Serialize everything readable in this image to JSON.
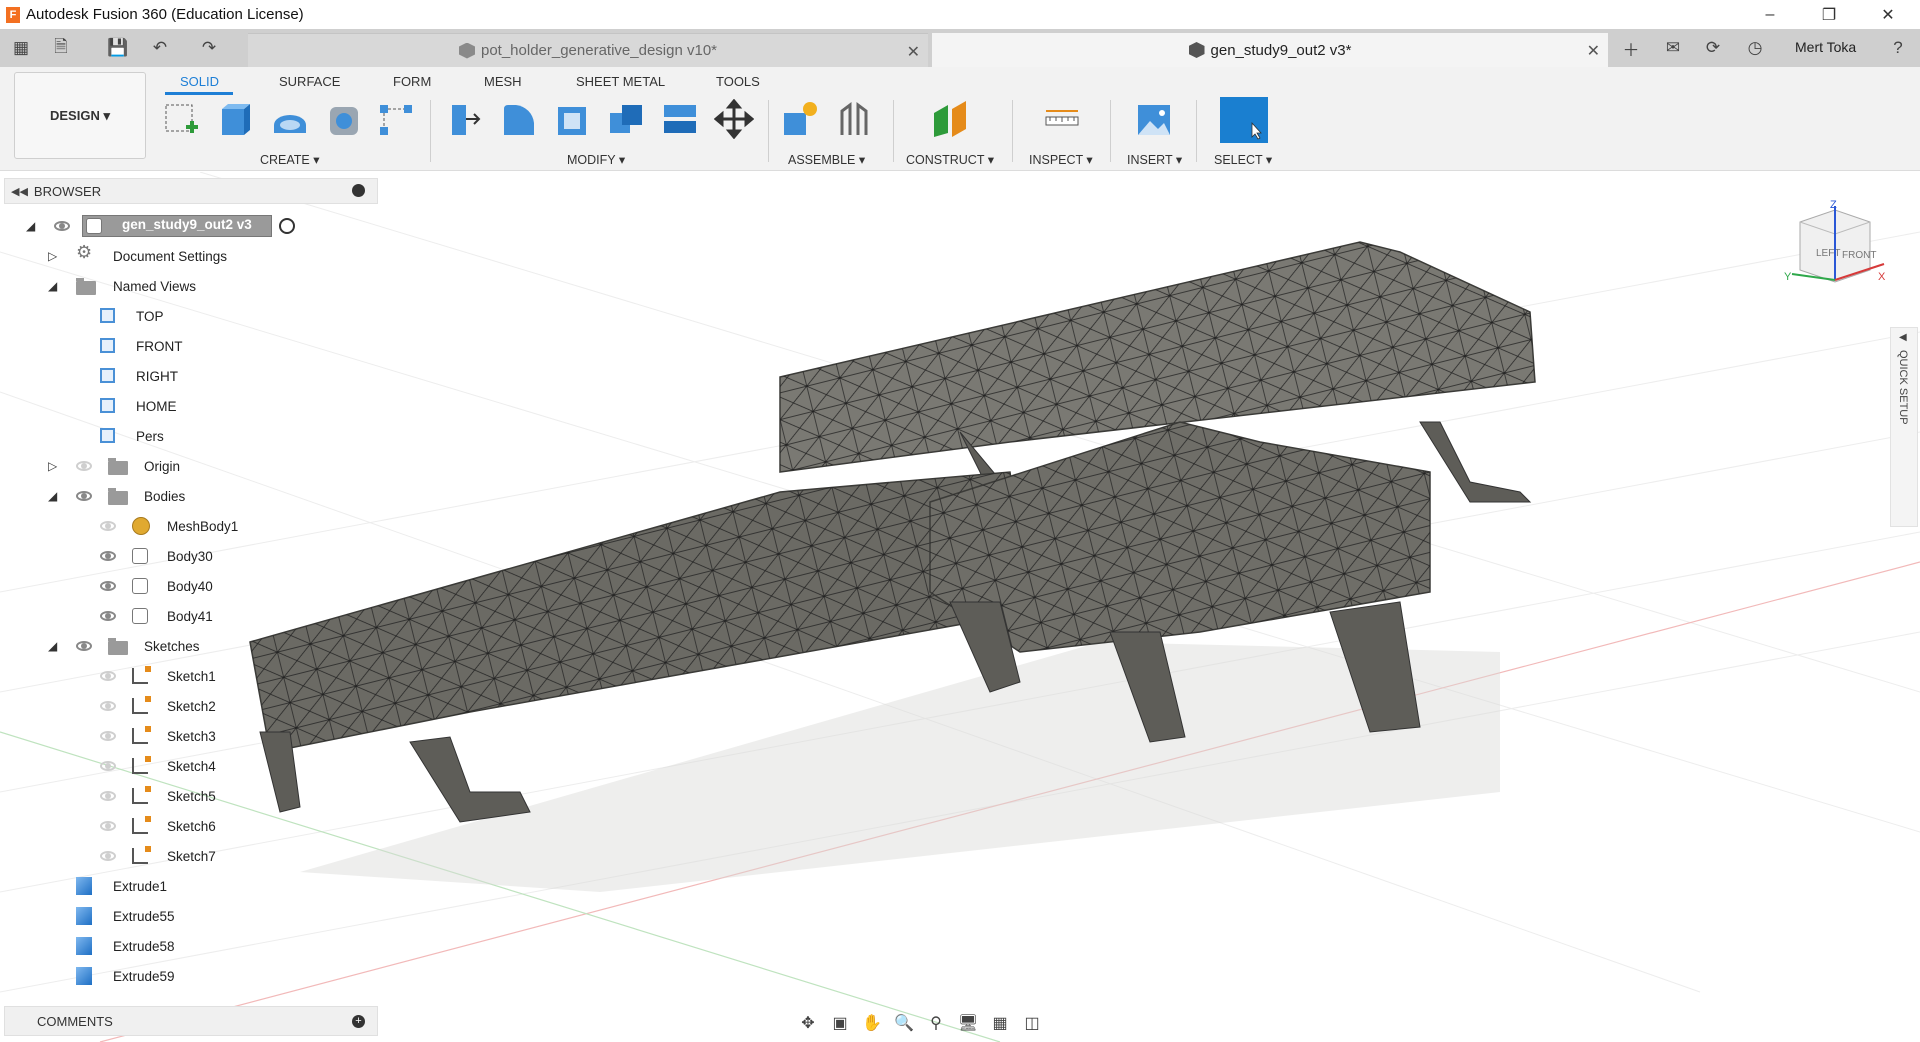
{
  "window": {
    "title": "Autodesk Fusion 360 (Education License)",
    "logo_letter": "F"
  },
  "tabs": [
    {
      "label": "pot_holder_generative_design v10*"
    },
    {
      "label": "gen_study9_out2 v3*"
    }
  ],
  "user": {
    "name": "Mert Toka"
  },
  "workspace": {
    "label": "DESIGN"
  },
  "ribbon_tabs": [
    "SOLID",
    "SURFACE",
    "FORM",
    "MESH",
    "SHEET METAL",
    "TOOLS"
  ],
  "ribbon_groups": {
    "create": "CREATE",
    "modify": "MODIFY",
    "assemble": "ASSEMBLE",
    "construct": "CONSTRUCT",
    "inspect": "INSPECT",
    "insert": "INSERT",
    "select": "SELECT"
  },
  "browser": {
    "title": "BROWSER",
    "root": "gen_study9_out2 v3",
    "document_settings": "Document Settings",
    "named_views": "Named Views",
    "views": [
      "TOP",
      "FRONT",
      "RIGHT",
      "HOME",
      "Pers"
    ],
    "origin": "Origin",
    "bodies": "Bodies",
    "body_items": [
      "MeshBody1",
      "Body30",
      "Body40",
      "Body41"
    ],
    "sketches": "Sketches",
    "sketch_items": [
      "Sketch1",
      "Sketch2",
      "Sketch3",
      "Sketch4",
      "Sketch5",
      "Sketch6",
      "Sketch7"
    ],
    "features": [
      "Extrude1",
      "Extrude55",
      "Extrude58",
      "Extrude59"
    ]
  },
  "comments": {
    "title": "COMMENTS"
  },
  "viewcube": {
    "left": "LEFT",
    "front": "FRONT",
    "z": "Z",
    "x": "X",
    "y": "Y"
  },
  "quick_setup": {
    "label": "QUICK SETUP"
  },
  "colors": {
    "accent": "#1e7fd6",
    "select_button": "#1a7fd0",
    "mesh_fill": "#6b6a64"
  }
}
